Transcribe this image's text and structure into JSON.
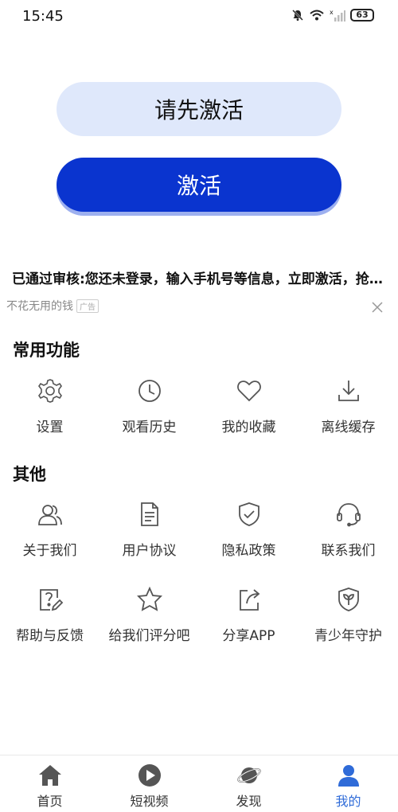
{
  "status_bar": {
    "time": "15:45",
    "battery": "63"
  },
  "buttons": {
    "hint_label": "请先激活",
    "activate_label": "激活"
  },
  "notice": "已通过审核:您还未登录，输入手机号等信息，立即激活，抢先体验",
  "ad": {
    "text": "不花无用的钱",
    "badge": "广告"
  },
  "sections": {
    "common": {
      "title": "常用功能",
      "items": [
        {
          "label": "设置",
          "icon": "gear-icon"
        },
        {
          "label": "观看历史",
          "icon": "clock-icon"
        },
        {
          "label": "我的收藏",
          "icon": "heart-icon"
        },
        {
          "label": "离线缓存",
          "icon": "download-icon"
        }
      ]
    },
    "other": {
      "title": "其他",
      "items": [
        {
          "label": "关于我们",
          "icon": "users-icon"
        },
        {
          "label": "用户协议",
          "icon": "document-icon"
        },
        {
          "label": "隐私政策",
          "icon": "shield-check-icon"
        },
        {
          "label": "联系我们",
          "icon": "headset-icon"
        },
        {
          "label": "帮助与反馈",
          "icon": "help-edit-icon"
        },
        {
          "label": "给我们评分吧",
          "icon": "star-icon"
        },
        {
          "label": "分享APP",
          "icon": "share-icon"
        },
        {
          "label": "青少年守护",
          "icon": "sprout-shield-icon"
        }
      ]
    }
  },
  "tabs": [
    {
      "label": "首页",
      "icon": "home-icon"
    },
    {
      "label": "短视频",
      "icon": "play-icon"
    },
    {
      "label": "发现",
      "icon": "planet-icon"
    },
    {
      "label": "我的",
      "icon": "person-icon",
      "active": true
    }
  ],
  "colors": {
    "primary": "#0a34cf",
    "hint_bg": "#dfe8fb",
    "tab_active": "#2f6bd8",
    "icon_stroke": "#555555"
  }
}
